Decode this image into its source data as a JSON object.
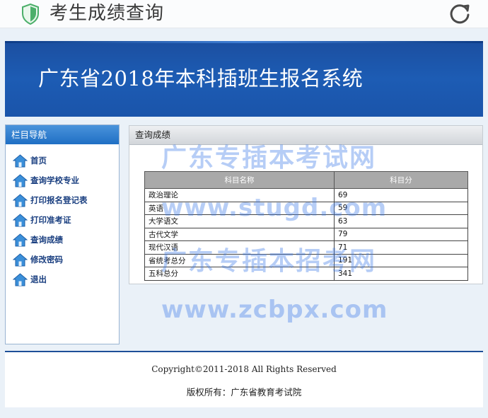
{
  "app_bar": {
    "title": "考生成绩查询",
    "shield_icon": "shield-check-icon",
    "refresh_icon": "refresh-icon"
  },
  "banner": {
    "title": "广东省2018年本科插班生报名系统"
  },
  "sidebar": {
    "title": "栏目导航",
    "items": [
      {
        "label": "首页",
        "icon": "house-icon"
      },
      {
        "label": "查询学校专业",
        "icon": "house-icon"
      },
      {
        "label": "打印报名登记表",
        "icon": "house-icon"
      },
      {
        "label": "打印准考证",
        "icon": "house-icon"
      },
      {
        "label": "查询成绩",
        "icon": "house-icon"
      },
      {
        "label": "修改密码",
        "icon": "house-icon"
      },
      {
        "label": "退出",
        "icon": "house-icon"
      }
    ]
  },
  "panel": {
    "title": "查询成绩",
    "table": {
      "headers": [
        "科目名称",
        "科目分"
      ],
      "rows": [
        [
          "政治理论",
          "69"
        ],
        [
          "英语",
          "59"
        ],
        [
          "大学语文",
          "63"
        ],
        [
          "古代文学",
          "79"
        ],
        [
          "现代汉语",
          "71"
        ],
        [
          "省统考总分",
          "191"
        ],
        [
          "五科总分",
          "341"
        ]
      ]
    }
  },
  "watermarks": [
    "广东专插本考试网",
    "www.stugd.com",
    "广东专插本招考网",
    "www.zcbpx.com"
  ],
  "footer": {
    "copyright": "Copyright©2011-2018 All Rights Reserved",
    "owner": "版权所有：广东省教育考试院"
  },
  "colors": {
    "banner_blue": "#1d5cb4",
    "nav_header_blue": "#2f7fd0",
    "nav_text": "#1a3f80",
    "watermark_blue": "#407ce8"
  }
}
